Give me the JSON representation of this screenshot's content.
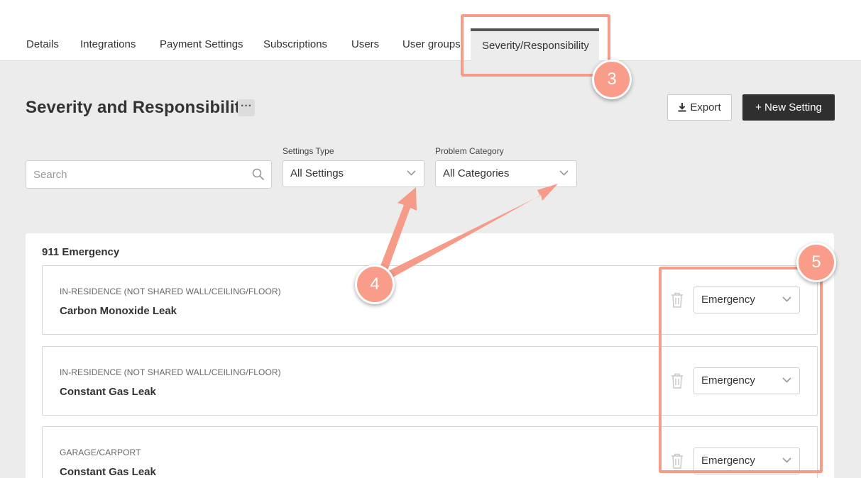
{
  "tabs": [
    {
      "label": "Details"
    },
    {
      "label": "Integrations"
    },
    {
      "label": "Payment Settings"
    },
    {
      "label": "Subscriptions"
    },
    {
      "label": "Users"
    },
    {
      "label": "User groups"
    },
    {
      "label": "Severity/Responsibility",
      "active": true
    }
  ],
  "page": {
    "title": "Severity and Responsibility",
    "more_label": "···",
    "export_label": "Export",
    "new_setting_label": "+ New Setting"
  },
  "filters": {
    "search_placeholder": "Search",
    "settings_type_label": "Settings Type",
    "settings_type_value": "All Settings",
    "problem_category_label": "Problem Category",
    "problem_category_value": "All Categories"
  },
  "group": {
    "title": "911 Emergency",
    "items": [
      {
        "category": "IN-RESIDENCE (NOT SHARED WALL/CEILING/FLOOR)",
        "name": "Carbon Monoxide Leak",
        "severity": "Emergency"
      },
      {
        "category": "IN-RESIDENCE (NOT SHARED WALL/CEILING/FLOOR)",
        "name": "Constant Gas Leak",
        "severity": "Emergency"
      },
      {
        "category": "GARAGE/CARPORT",
        "name": "Constant Gas Leak",
        "severity": "Emergency"
      }
    ]
  },
  "annotations": {
    "badge_3": "3",
    "badge_4": "4",
    "badge_5": "5",
    "color": "#f59b87"
  },
  "icons": {
    "search": "search-icon",
    "download": "download-icon",
    "chevron": "chevron-down-icon",
    "trash": "trash-icon"
  }
}
